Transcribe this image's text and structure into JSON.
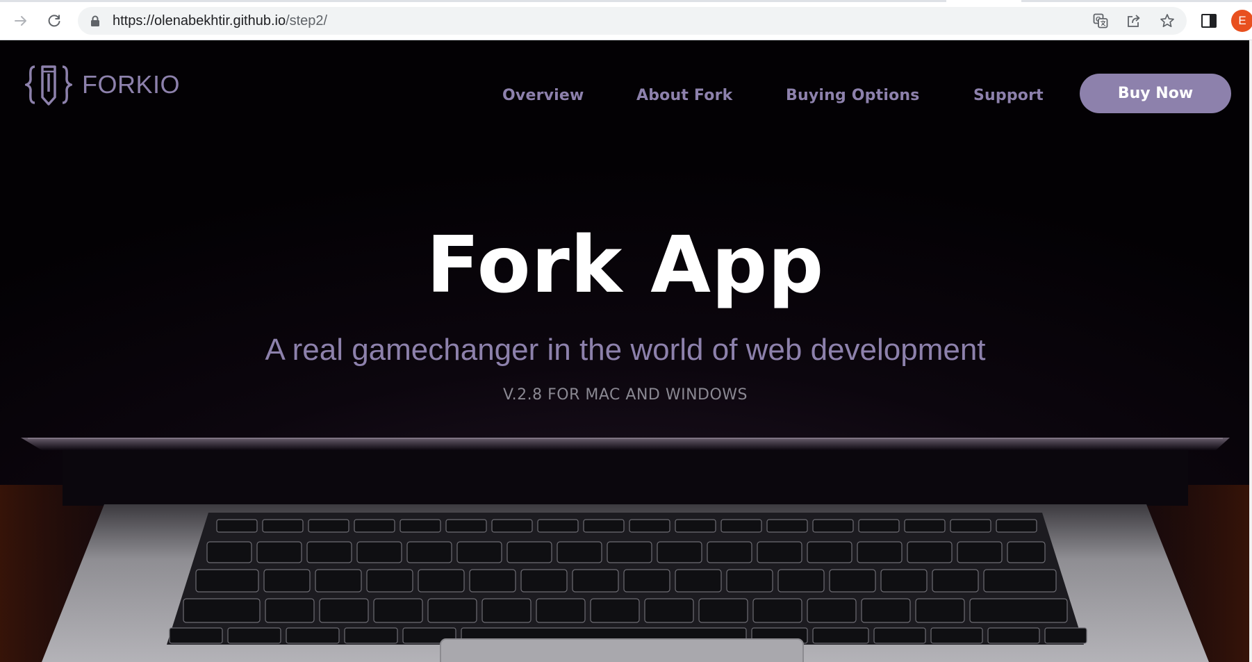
{
  "browser": {
    "url_host": "https://olenabekhtir.github.io",
    "url_path": "/step2/",
    "profile_initial": "E",
    "icons": [
      "forward-icon",
      "reload-icon",
      "lock-icon",
      "translate-icon",
      "share-icon",
      "star-icon",
      "side-panel-icon"
    ]
  },
  "site": {
    "logo_text": "FORKIO",
    "nav": {
      "overview": "Overview",
      "about": "About Fork",
      "buying": "Buying Options",
      "support": "Support"
    },
    "buy_now": "Buy Now",
    "hero": {
      "title": "Fork App",
      "subtitle": "A real gamechanger in the world of web development",
      "version": "V.2.8 FOR MAC AND WINDOWS"
    }
  },
  "colors": {
    "accent": "#8d81ac",
    "background": "#040206",
    "title": "#ffffff",
    "version_text": "#8a8892",
    "avatar": "#e8501f"
  }
}
